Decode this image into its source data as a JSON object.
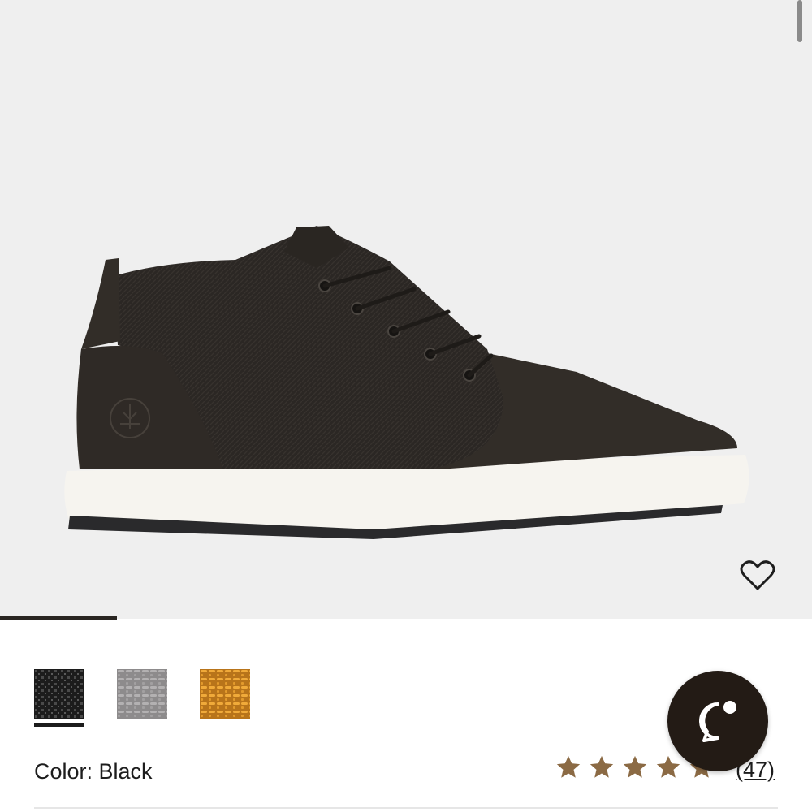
{
  "product": {
    "color_label": "Color: Black",
    "rating": 5,
    "review_count_label": "(47)"
  },
  "swatches": [
    {
      "name": "black",
      "color": "#2b2b2b",
      "selected": true
    },
    {
      "name": "grey",
      "color": "#9a9899",
      "selected": false
    },
    {
      "name": "wheat",
      "color": "#e09a2a",
      "selected": false
    }
  ],
  "icons": {
    "wishlist": "heart-icon",
    "chat": "chat-bubble-icon",
    "rating": "star-icon"
  },
  "colors": {
    "gallery_bg": "#efefef",
    "star": "#8b6a44",
    "chat_bg": "#231b15"
  }
}
